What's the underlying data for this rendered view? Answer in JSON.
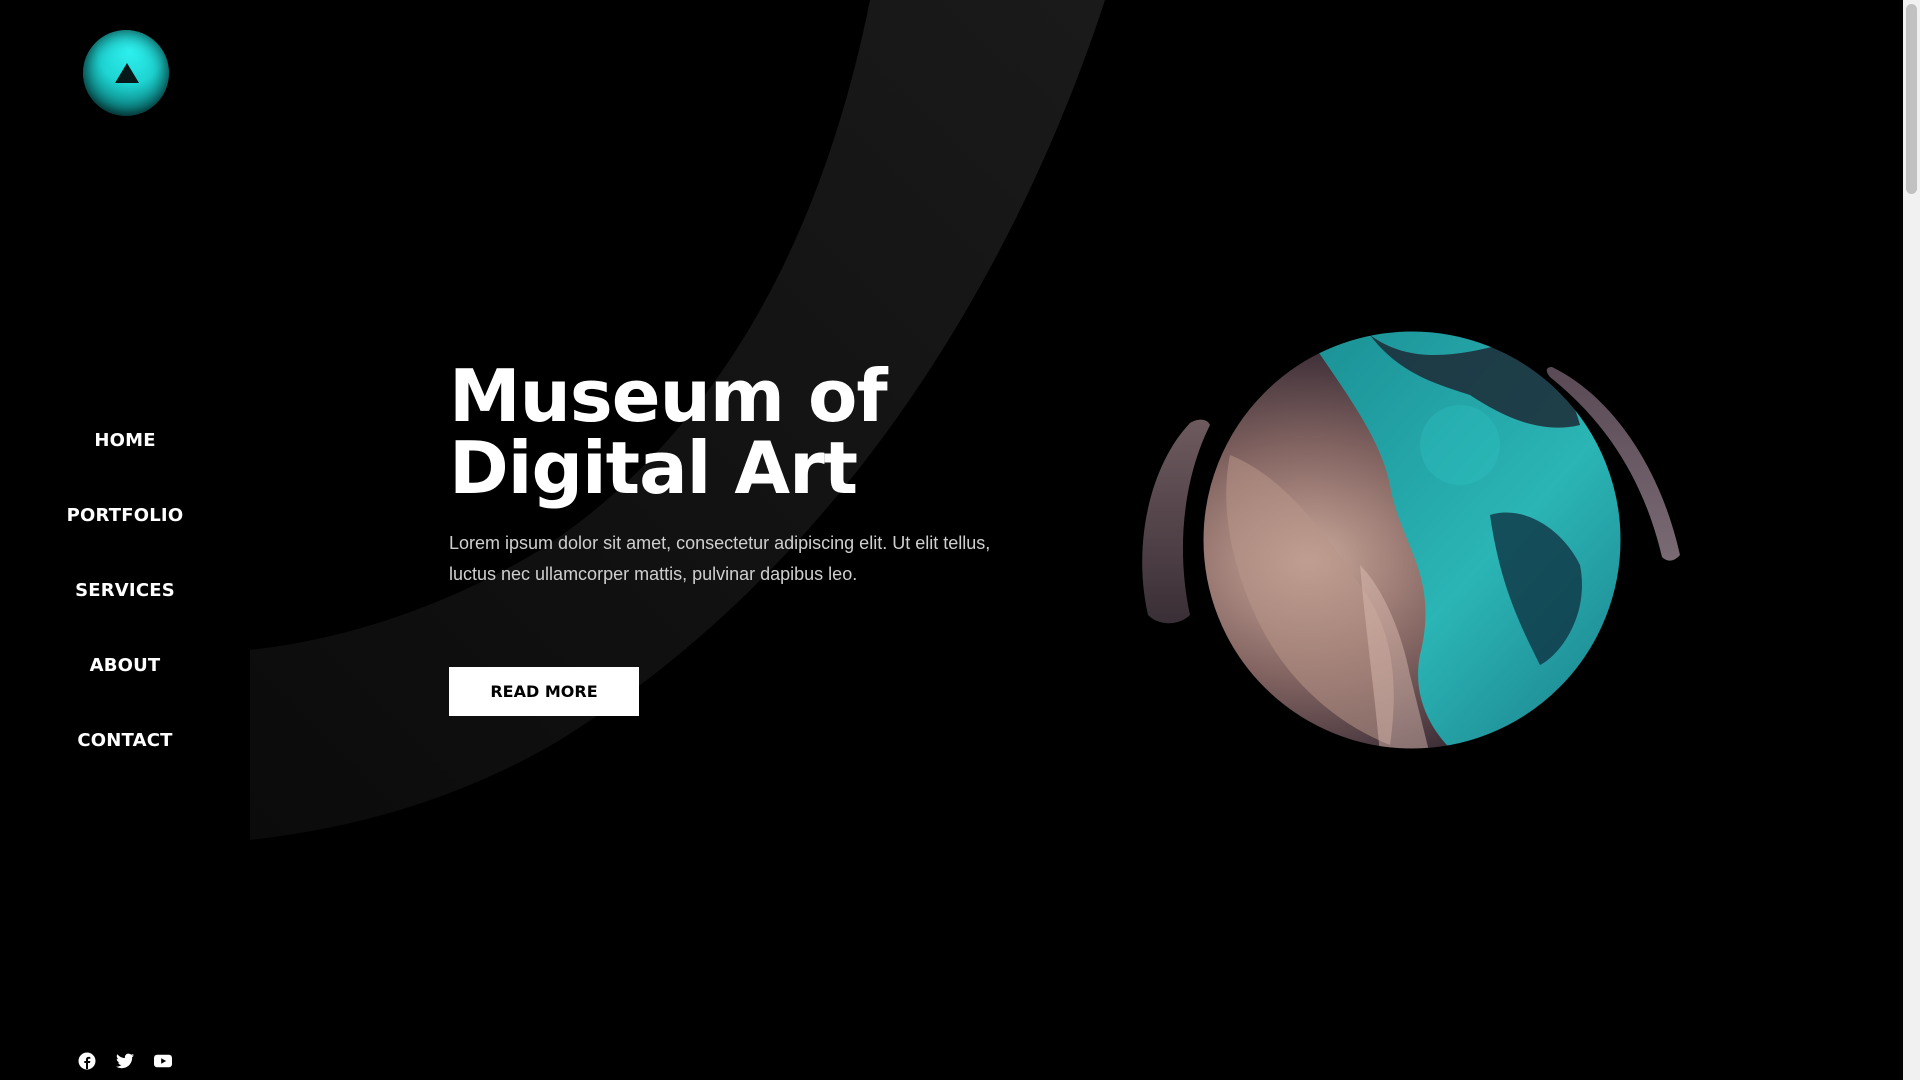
{
  "brand": {
    "logo_icon": "triangle-logo-icon",
    "accent_color": "#1ed5d3"
  },
  "nav": {
    "items": [
      {
        "label": "HOME"
      },
      {
        "label": "PORTFOLIO"
      },
      {
        "label": "SERVICES"
      },
      {
        "label": "ABOUT"
      },
      {
        "label": "CONTACT"
      }
    ]
  },
  "hero": {
    "title_line1": "Museum of",
    "title_line2": "Digital Art",
    "description": " Lorem ipsum dolor sit amet, consectetur adipiscing elit. Ut elit tellus, luctus nec ullamcorper mattis, pulvinar dapibus leo.",
    "button_label": "READ MORE"
  },
  "social": {
    "icons": [
      "facebook-icon",
      "twitter-icon",
      "youtube-icon"
    ]
  },
  "colors": {
    "background": "#000000",
    "text": "#ffffff",
    "button_bg": "#ffffff",
    "button_text": "#000000"
  }
}
